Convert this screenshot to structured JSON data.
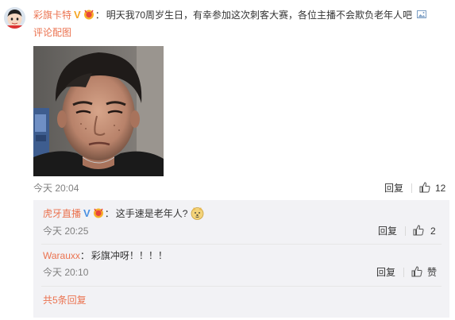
{
  "comment": {
    "username": "彩旗卡特",
    "verified_badge": "V",
    "colon": "：",
    "text": "明天我70周岁生日，有幸参加这次刺客大赛，各位主播不会欺负老年人吧",
    "pic_link_icon": "image-icon",
    "reply_pic_link": "评论配图",
    "time": "今天 20:04",
    "reply_label": "回复",
    "like_count": "12",
    "like_icon": "thumbs-up-icon"
  },
  "replies": [
    {
      "username": "虎牙直播",
      "verified_badge": "V",
      "colon": "：",
      "text": "这手速是老年人?",
      "emoji": "doge-face",
      "time": "今天 20:25",
      "reply_label": "回复",
      "like_count": "2"
    },
    {
      "username": "Warauxx",
      "colon": "：",
      "text": "彩旗冲呀！！！！",
      "time": "今天 20:10",
      "reply_label": "回复",
      "like_label": "赞"
    }
  ],
  "more_replies": "共5条回复",
  "colors": {
    "username": "#eb7350",
    "link": "#eb7350",
    "verified": "#f5a623",
    "meta": "#808080",
    "subbox_bg": "#f2f2f5"
  }
}
